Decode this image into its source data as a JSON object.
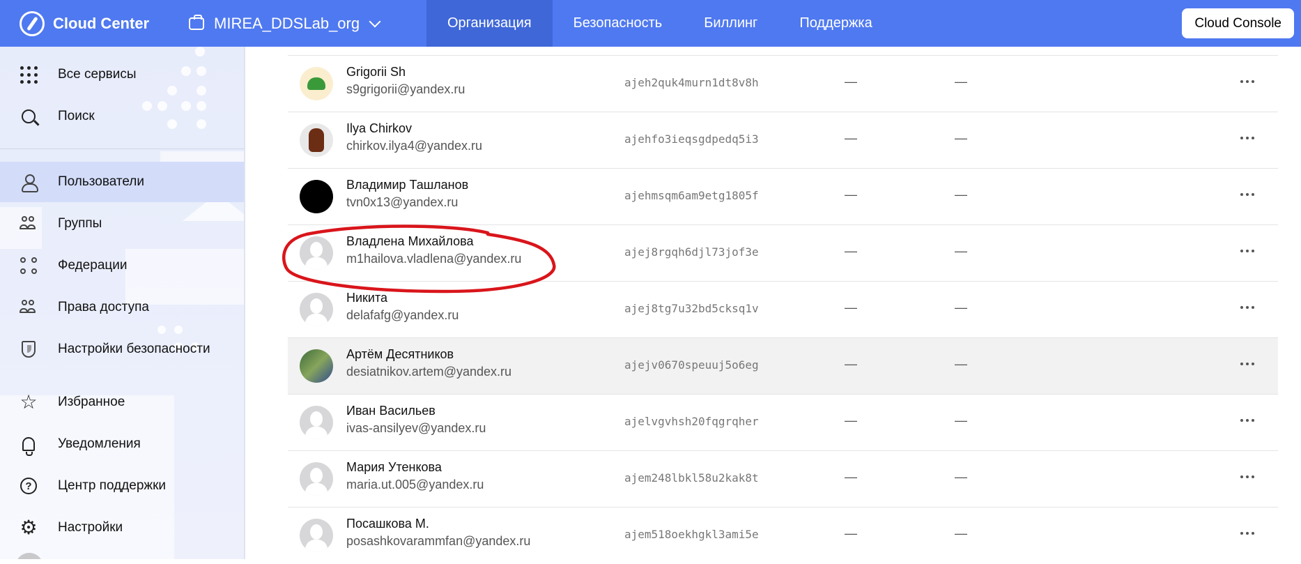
{
  "header": {
    "brand": "Cloud Center",
    "org_name": "MIREA_DDSLab_org",
    "tabs": [
      {
        "label": "Организация",
        "active": true
      },
      {
        "label": "Безопасность",
        "active": false
      },
      {
        "label": "Биллинг",
        "active": false
      },
      {
        "label": "Поддержка",
        "active": false
      }
    ],
    "console_button": "Cloud Console",
    "accent_color": "#4f79f0"
  },
  "sidebar": {
    "items": [
      {
        "label": "Все сервисы",
        "icon": "grid-icon"
      },
      {
        "label": "Поиск",
        "icon": "search-icon"
      },
      {
        "label": "Пользователи",
        "icon": "user-icon",
        "active": true
      },
      {
        "label": "Группы",
        "icon": "group-icon"
      },
      {
        "label": "Федерации",
        "icon": "federation-icon"
      },
      {
        "label": "Права доступа",
        "icon": "access-icon"
      },
      {
        "label": "Настройки безопасности",
        "icon": "shield-icon"
      },
      {
        "label": "Избранное",
        "icon": "star-icon"
      },
      {
        "label": "Уведомления",
        "icon": "bell-icon"
      },
      {
        "label": "Центр поддержки",
        "icon": "help-icon"
      },
      {
        "label": "Настройки",
        "icon": "gear-icon"
      }
    ]
  },
  "users": [
    {
      "name": "Grigorii Sh",
      "email": "s9grigorii@yandex.ru",
      "id": "ajeh2quk4murn1dt8v8h",
      "col1": "—",
      "col2": "—",
      "avatar": "dino"
    },
    {
      "name": "Ilya Chirkov",
      "email": "chirkov.ilya4@yandex.ru",
      "id": "ajehfo3ieqsgdpedq5i3",
      "col1": "—",
      "col2": "—",
      "avatar": "photo1"
    },
    {
      "name": "Владимир Ташланов",
      "email": "tvn0x13@yandex.ru",
      "id": "ajehmsqm6am9etg1805f",
      "col1": "—",
      "col2": "—",
      "avatar": "black"
    },
    {
      "name": "Владлена Михайлова",
      "email": "m1hailova.vladlena@yandex.ru",
      "id": "ajej8rgqh6djl73jof3e",
      "col1": "—",
      "col2": "—",
      "avatar": "default",
      "circled": true
    },
    {
      "name": "Никита",
      "email": "delafafg@yandex.ru",
      "id": "ajej8tg7u32bd5cksq1v",
      "col1": "—",
      "col2": "—",
      "avatar": "default"
    },
    {
      "name": "Артём Десятников",
      "email": "desiatnikov.artem@yandex.ru",
      "id": "ajejv0670speuuj5o6eg",
      "col1": "—",
      "col2": "—",
      "avatar": "photo2",
      "hover": true
    },
    {
      "name": "Иван Васильев",
      "email": "ivas-ansilyev@yandex.ru",
      "id": "ajelvgvhsh20fqgrqher",
      "col1": "—",
      "col2": "—",
      "avatar": "default"
    },
    {
      "name": "Мария Утенкова",
      "email": "maria.ut.005@yandex.ru",
      "id": "ajem248lbkl58u2kak8t",
      "col1": "—",
      "col2": "—",
      "avatar": "default"
    },
    {
      "name": "Посашкова М.",
      "email": "posashkovarammfan@yandex.ru",
      "id": "ajem518oekhgkl3ami5e",
      "col1": "—",
      "col2": "—",
      "avatar": "default"
    }
  ],
  "annotation_color": "#d9151b"
}
